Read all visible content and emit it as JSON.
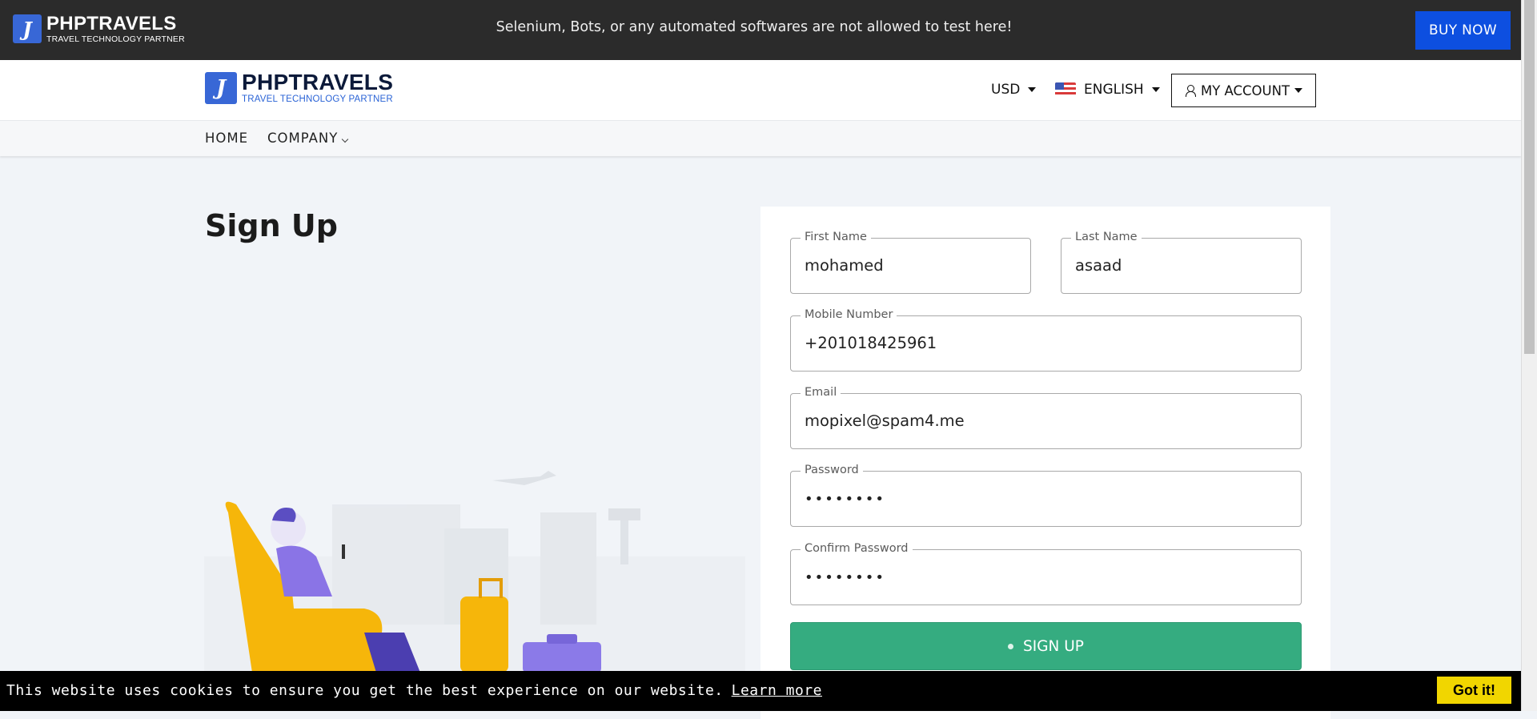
{
  "topbar": {
    "brand_name": "PHPTRAVELS",
    "brand_tag": "TRAVEL TECHNOLOGY PARTNER",
    "notice": "Selenium, Bots, or any automated softwares are not allowed to test here!",
    "buy_now": "BUY NOW"
  },
  "header": {
    "brand_name": "PHPTRAVELS",
    "brand_tag": "TRAVEL TECHNOLOGY PARTNER",
    "currency": "USD",
    "language": "ENGLISH",
    "account": "MY ACCOUNT"
  },
  "nav": {
    "home": "HOME",
    "company": "COMPANY"
  },
  "page": {
    "title": "Sign Up"
  },
  "form": {
    "first_name": {
      "label": "First Name",
      "value": "mohamed"
    },
    "last_name": {
      "label": "Last Name",
      "value": "asaad"
    },
    "mobile": {
      "label": "Mobile Number",
      "value": "+201018425961"
    },
    "email": {
      "label": "Email",
      "value": "mopixel@spam4.me"
    },
    "password": {
      "label": "Password",
      "value": "••••••••"
    },
    "confirm_password": {
      "label": "Confirm Password",
      "value": "••••••••"
    },
    "submit": "SIGN UP"
  },
  "cookie": {
    "text": "This website uses cookies to ensure you get the best experience on our website.",
    "learn_more": "Learn more",
    "got_it": "Got it!"
  },
  "colors": {
    "topbar_bg": "#2b2b2b",
    "buy_now": "#0d4fe0",
    "signup_green": "#35ac80",
    "cookie_button": "#f1d600",
    "brand_blue": "#3867d6"
  }
}
